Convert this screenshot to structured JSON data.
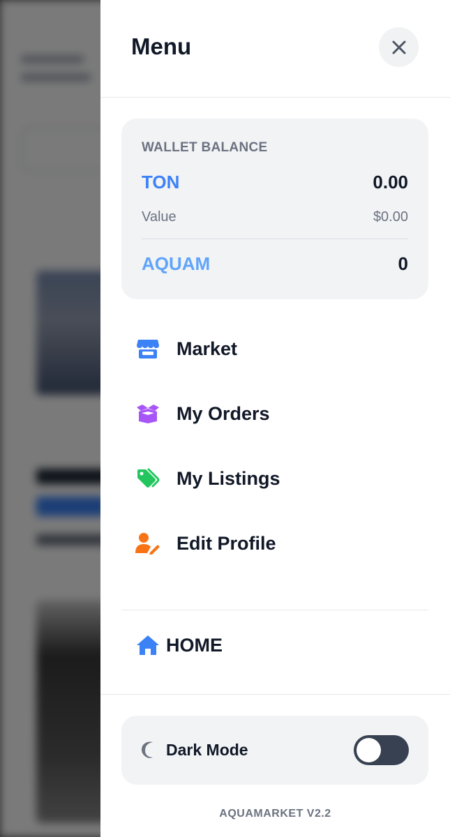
{
  "drawer": {
    "title": "Menu"
  },
  "wallet": {
    "heading": "WALLET BALANCE",
    "ton_label": "TON",
    "ton_value": "0.00",
    "value_label": "Value",
    "value_amount": "$0.00",
    "aquam_label": "AQUAM",
    "aquam_value": "0"
  },
  "menu": {
    "items": [
      {
        "label": "Market",
        "icon": "store-icon",
        "color": "#3b82f6"
      },
      {
        "label": "My Orders",
        "icon": "box-open-icon",
        "color": "#a855f7"
      },
      {
        "label": "My Listings",
        "icon": "tags-icon",
        "color": "#22c55e"
      },
      {
        "label": "Edit Profile",
        "icon": "user-edit-icon",
        "color": "#f97316"
      }
    ],
    "home_label": "HOME"
  },
  "settings": {
    "dark_mode_label": "Dark Mode",
    "dark_mode_enabled": false
  },
  "footer": {
    "version": "AQUAMARKET V2.2"
  }
}
